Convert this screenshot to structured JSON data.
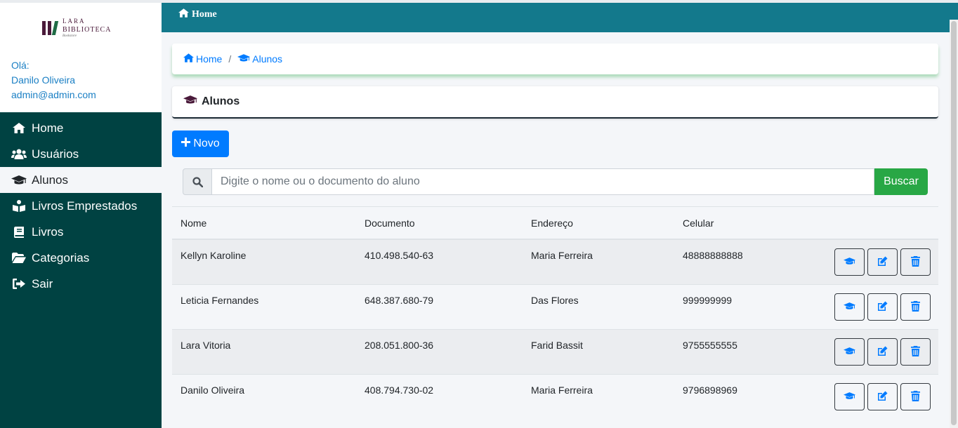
{
  "brand": {
    "line1": "LARA",
    "line2": "BIBLIOTECA",
    "line3": "Bookstore",
    "bar_colors": [
      "#4a1a3a",
      "#4a1a3a",
      "#1f6b45"
    ]
  },
  "user": {
    "greeting": "Olá:",
    "name": "Danilo Oliveira",
    "email": "admin@admin.com"
  },
  "sidebar": {
    "items": [
      {
        "label": "Home",
        "icon": "home-icon"
      },
      {
        "label": "Usuários",
        "icon": "users-icon"
      },
      {
        "label": "Alunos",
        "icon": "graduation-cap-icon",
        "active": true
      },
      {
        "label": "Livros Emprestados",
        "icon": "book-reader-icon"
      },
      {
        "label": "Livros",
        "icon": "book-icon"
      },
      {
        "label": "Categorias",
        "icon": "folder-open-icon"
      },
      {
        "label": "Sair",
        "icon": "sign-out-icon"
      }
    ]
  },
  "header": {
    "home_label": "Home"
  },
  "breadcrumb": {
    "home": "Home",
    "separator": "/",
    "current": "Alunos"
  },
  "page": {
    "title": "Alunos"
  },
  "actions": {
    "new_label": "Novo"
  },
  "search": {
    "placeholder": "Digite o nome ou o documento do aluno",
    "value": "",
    "button_label": "Buscar"
  },
  "table": {
    "headers": [
      "Nome",
      "Documento",
      "Endereço",
      "Celular"
    ],
    "rows": [
      {
        "nome": "Kellyn Karoline",
        "documento": "410.498.540-63",
        "endereco": "Maria Ferreira",
        "celular": "48888888888"
      },
      {
        "nome": "Leticia Fernandes",
        "documento": "648.387.680-79",
        "endereco": "Das Flores",
        "celular": "999999999"
      },
      {
        "nome": "Lara Vitoria",
        "documento": "208.051.800-36",
        "endereco": "Farid Bassit",
        "celular": "9755555555"
      },
      {
        "nome": "Danilo Oliveira",
        "documento": "408.794.730-02",
        "endereco": "Maria Ferreira",
        "celular": "9796898969"
      }
    ],
    "row_actions": [
      "graduation-cap-icon",
      "edit-icon",
      "trash-icon"
    ]
  },
  "colors": {
    "sidebar": "#004242",
    "header": "#13798c",
    "primary": "#007bff",
    "success": "#28a745"
  }
}
